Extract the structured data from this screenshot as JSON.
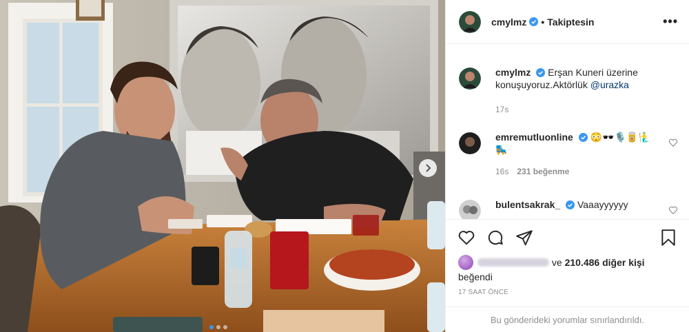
{
  "media": {
    "slides_total": 3,
    "active_slide": 1
  },
  "header": {
    "username": "cmylmz",
    "separator": "•",
    "follow_status": "Takiptesin",
    "more": "•••"
  },
  "caption": {
    "username": "cmylmz",
    "text": "Erşan Kuneri üzerine konuşuyoruz.Aktörlük ",
    "mention": "@urazka",
    "time": "17s"
  },
  "comments": [
    {
      "username": "emremutluonline",
      "text": "😳🕶️🎙️🥫🧜‍♂️ 🛼",
      "time": "16s",
      "likes": "231 beğenme"
    },
    {
      "username": "bulentsakrak_",
      "text": "Vaaayyyyyy"
    }
  ],
  "likes": {
    "prefix": "ve",
    "count_text": "210.486 diğer kişi",
    "suffix": "beğendi"
  },
  "timeago": "17 SAAT ÖNCE",
  "restricted_notice": "Bu gönderideki yorumlar sınırlandırıldı.",
  "colors": {
    "verified": "#3897f0",
    "mention": "#00376b",
    "muted": "#8e8e8e"
  }
}
